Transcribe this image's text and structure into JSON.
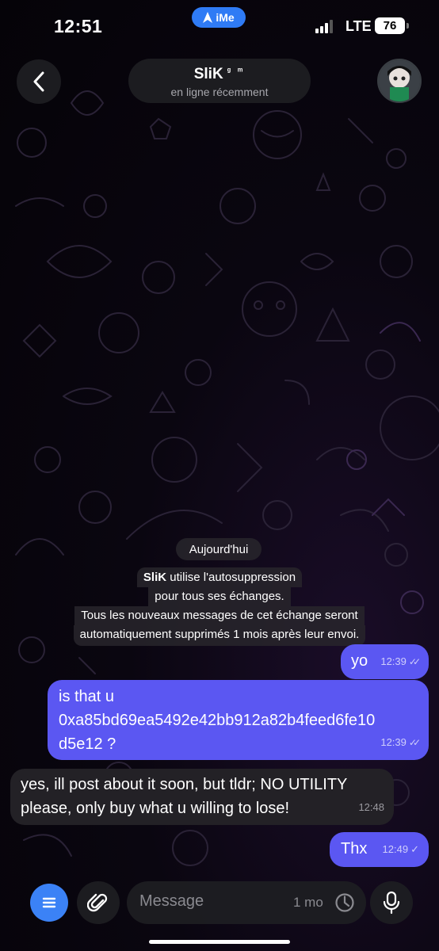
{
  "status_bar": {
    "time": "12:51",
    "app_badge": "iMe",
    "network": "LTE",
    "battery": "76"
  },
  "header": {
    "name": "SliK",
    "name_suffix": "ᵍ ᵐ",
    "status": "en ligne récemment"
  },
  "date_label": "Aujourd'hui",
  "service_message": {
    "name": "SliK",
    "line1_rest": " utilise l'autosuppression",
    "line2": "pour tous ses échanges.",
    "line3": "Tous les nouveaux messages de cet échange seront",
    "line4": "automatiquement supprimés 1 mois après leur envoi."
  },
  "messages": [
    {
      "direction": "out",
      "lines": [
        "yo"
      ],
      "time": "12:39",
      "status": "read"
    },
    {
      "direction": "out",
      "lines": [
        "is that u",
        "0xa85bd69ea5492e42bb912a82b4feed6fe10",
        "d5e12 ?"
      ],
      "time": "12:39",
      "status": "read"
    },
    {
      "direction": "in",
      "lines": [
        "yes, ill post about it soon, but tldr; NO UTILITY",
        "please, only buy what u willing to lose!"
      ],
      "time": "12:48"
    },
    {
      "direction": "out",
      "lines": [
        "Thx"
      ],
      "time": "12:49",
      "status": "sent"
    }
  ],
  "input": {
    "placeholder": "Message",
    "timer": "1 mo"
  },
  "colors": {
    "outgoing": "#5b57f2",
    "incoming": "#232126",
    "accent": "#3b82f6"
  }
}
